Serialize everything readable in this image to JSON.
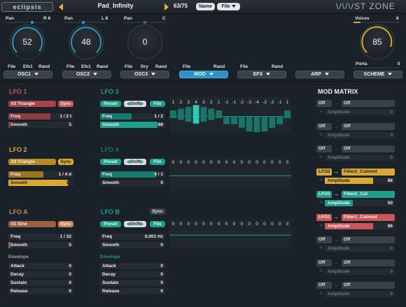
{
  "header": {
    "logo": "eclipsis",
    "preset_name": "Pad_Infinity",
    "preset_count": "63/75",
    "name_btn": "Name",
    "file_btn": "File",
    "brand": "\\/\\/\\/ST ZONE"
  },
  "osc": [
    {
      "pan_label": "Pan",
      "pan_value": "R 8",
      "knob_value": "52",
      "file": "File",
      "efx": "Efx1",
      "rand": "Rand",
      "select": "OSC1"
    },
    {
      "pan_label": "Pan",
      "pan_value": "L 8",
      "knob_value": "48",
      "file": "File",
      "efx": "Efx1",
      "rand": "Rand",
      "select": "OSC2"
    },
    {
      "pan_label": "Pan",
      "pan_value": "C",
      "knob_value": "0",
      "file": "File",
      "efx": "Dry",
      "rand": "Rand",
      "select": "OSC3"
    }
  ],
  "voices": {
    "label": "Voices",
    "value": "8",
    "knob_value": "85",
    "porta_label": "Porta",
    "porta_value": "0"
  },
  "tabs": {
    "mod": {
      "file": "File",
      "rand": "Rand",
      "label": "MOD"
    },
    "efx": {
      "label": "EFX"
    },
    "arp": {
      "label": "ARP"
    },
    "scheme": {
      "label": "SCHEME"
    }
  },
  "lfo1": {
    "title": "LFO 1",
    "wave": "03 Triangle",
    "sync": "Sync",
    "freq_label": "Freq",
    "freq_value": "1 / 2 t",
    "smooth_label": "Smooth",
    "smooth_value": "5"
  },
  "lfo2": {
    "title": "LFO 2",
    "wave": "03 Triangle",
    "sync": "Sync",
    "freq_label": "Freq",
    "freq_value": "1 / 4 d",
    "smooth_label": "Smooth",
    "smooth_value": "91"
  },
  "lfoa": {
    "title": "LFO A",
    "wave": "01 Sine",
    "sync": "Sync",
    "freq_label": "Freq",
    "freq_value": "1 / 32",
    "smooth_label": "Smooth",
    "smooth_value": "5",
    "env_label": "Envelope",
    "attack_label": "Attack",
    "attack_value": "0",
    "decay_label": "Decay",
    "decay_value": "0",
    "sustain_label": "Sustain",
    "sustain_value": "0",
    "release_label": "Release",
    "release_value": "0"
  },
  "lfo3": {
    "title": "LFO 3",
    "preset": "Preset",
    "shift": "Shift",
    "file": "File",
    "freq_label": "Freq",
    "freq_value": "1 / 2",
    "smooth_label": "Smooth",
    "smooth_value": "88",
    "steps": [
      "1",
      "2",
      "3",
      "4",
      "3",
      "2",
      "1",
      "-1",
      "-1",
      "-2",
      "-3",
      "-4",
      "-3",
      "-2",
      "-1",
      "1"
    ]
  },
  "lfo4": {
    "title": "LFO 4",
    "preset": "Preset",
    "shift": "Shift",
    "file": "File",
    "freq_label": "Freq",
    "freq_value": "4 / 1",
    "smooth_label": "Smooth",
    "smooth_value": "0",
    "steps": [
      "0",
      "0",
      "0",
      "0",
      "0",
      "0",
      "0",
      "0",
      "0",
      "0",
      "0",
      "0",
      "0",
      "0",
      "0",
      "0"
    ]
  },
  "lfob": {
    "title": "LFO B",
    "sync": "Sync",
    "preset": "Preset",
    "shift": "Shift",
    "file": "File",
    "freq_label": "Freq",
    "freq_value": "0.001 Hz",
    "smooth_label": "Smooth",
    "smooth_value": "0",
    "env_label": "Envelope",
    "attack_label": "Attack",
    "attack_value": "0",
    "decay_label": "Decay",
    "decay_value": "0",
    "sustain_label": "Sustain",
    "sustain_value": "0",
    "release_label": "Release",
    "release_value": "0",
    "steps": [
      "0",
      "0",
      "0",
      "0",
      "0",
      "0",
      "0",
      "0",
      "0",
      "0",
      "0",
      "0",
      "0",
      "0",
      "0",
      "0"
    ]
  },
  "mod_matrix": {
    "title": "MOD MATRIX",
    "rows": [
      {
        "src": "Off",
        "dst": "Off",
        "amt_label": "Amplitude",
        "amt": "0",
        "active": false
      },
      {
        "src": "Off",
        "dst": "Off",
        "amt_label": "Amplitude",
        "amt": "0",
        "active": false
      },
      {
        "src": "Off",
        "dst": "Off",
        "amt_label": "Amplitude",
        "amt": "0",
        "active": false
      },
      {
        "src": "LFO2",
        "dst": "Filter2_Cutmod",
        "amt_label": "Amplitude",
        "amt": "86",
        "active": true,
        "color": "#d9a933"
      },
      {
        "src": "LFO3",
        "dst": "Filter2_Cut",
        "amt_label": "Amplitude",
        "amt": "50",
        "active": true,
        "color": "#1f9e8e"
      },
      {
        "src": "LFO1",
        "dst": "Filter1_Cutmod",
        "amt_label": "Amplitude",
        "amt": "86",
        "active": true,
        "color": "#c9565a"
      },
      {
        "src": "Off",
        "dst": "Off",
        "amt_label": "Amplitude",
        "amt": "0",
        "active": false
      },
      {
        "src": "Off",
        "dst": "Off",
        "amt_label": "Amplitude",
        "amt": "0",
        "active": false
      },
      {
        "src": "Off",
        "dst": "Off",
        "amt_label": "Amplitude",
        "amt": "0",
        "active": false
      }
    ]
  },
  "colors": {
    "lfo1": "#c9565a",
    "lfo2": "#d9a933",
    "lfoa": "#c98553",
    "lfo3": "#1f9e8e",
    "mod_tab": "#2f93c4",
    "accent": "#e3b23c"
  }
}
